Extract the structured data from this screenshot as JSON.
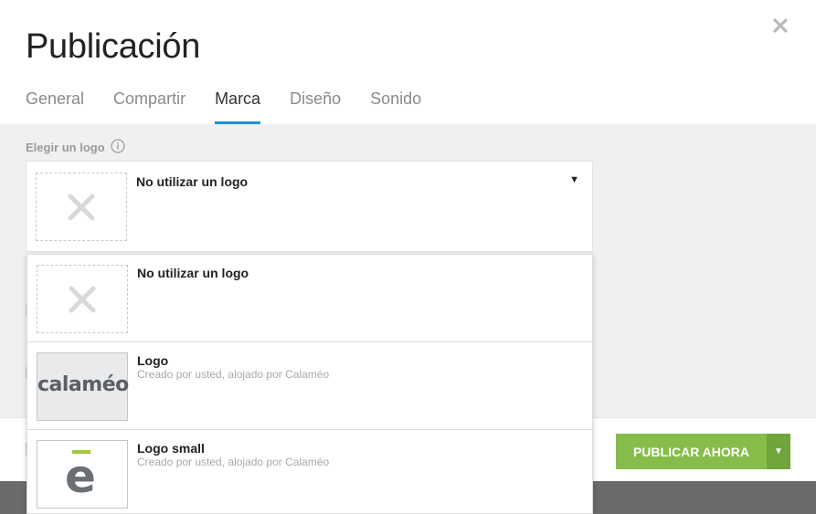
{
  "modal": {
    "title": "Publicación"
  },
  "tabs": [
    {
      "label": "General"
    },
    {
      "label": "Compartir"
    },
    {
      "label": "Marca"
    },
    {
      "label": "Diseño"
    },
    {
      "label": "Sonido"
    }
  ],
  "active_tab": "Marca",
  "logo_section": {
    "label": "Elegir un logo",
    "selected": {
      "title": "No utilizar un logo"
    }
  },
  "dropdown": {
    "options": [
      {
        "title": "No utilizar un logo",
        "subtitle": ""
      },
      {
        "title": "Logo",
        "subtitle": "Creado por usted, alojado por Calaméo",
        "thumb_text": "calaméo"
      },
      {
        "title": "Logo small",
        "subtitle": "Creado por usted, alojado por Calaméo",
        "thumb_text": "e"
      }
    ]
  },
  "footer": {
    "publish_label": "PUBLICAR AHORA"
  },
  "colors": {
    "accent_tab": "#1b97d6",
    "publish_button": "#86bd4a",
    "publish_arrow": "#6fa53a"
  },
  "icons": {
    "close": "close-icon",
    "info": "info-icon",
    "caret": "caret-down-icon",
    "empty_logo": "x-icon"
  }
}
